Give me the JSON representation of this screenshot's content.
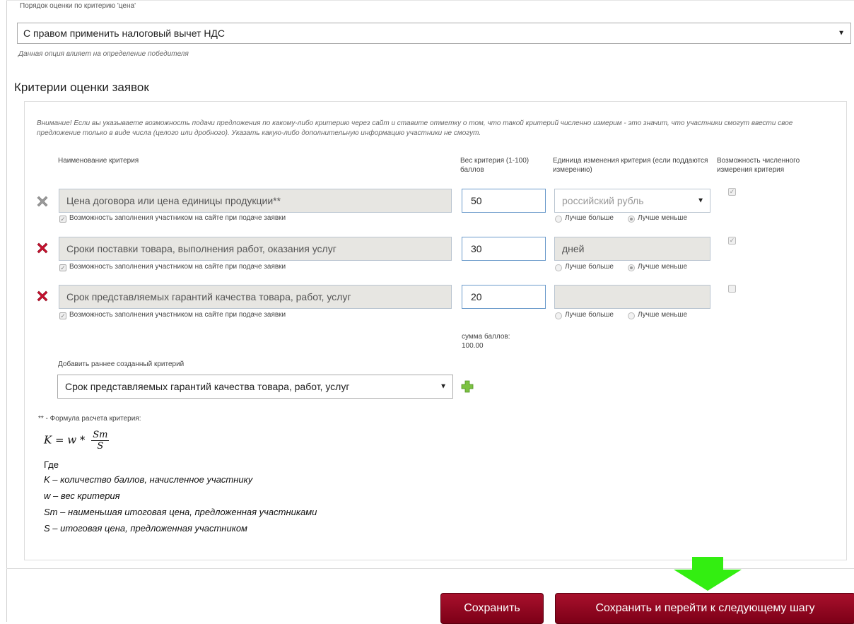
{
  "vat": {
    "label": "Порядок оценки по критерию 'цена'",
    "value": "С правом применить налоговый вычет НДС",
    "hint": "Данная опция влияет на определение победителя"
  },
  "section_title": "Критерии оценки заявок",
  "warning": "Внимание! Если вы указываете возможность подачи предложения по какому-либо критерию через сайт и ставите отметку о том, что такой критерий численно измерим - это значит, что участники смогут ввести свое предложение только в виде числа (целого или дробного). Указать какую-либо дополнительную информацию участники не смогут.",
  "columns": {
    "name": "Наименование критерия",
    "weight": "Вес критерия (1-100) баллов",
    "unit": "Единица изменения критерия (если поддаются измерению)",
    "measurable": "Возможность численного измерения критерия"
  },
  "criteria": [
    {
      "name": "Цена договора или цена единицы продукции**",
      "weight": "50",
      "unit": "российский рубль",
      "site_fill_label": "Возможность заполнения участником на сайте при подаче заявки",
      "better_more": "Лучше больше",
      "better_less": "Лучше меньше",
      "measurable_checked": true
    },
    {
      "name": "Сроки поставки товара, выполнения работ, оказания услуг",
      "weight": "30",
      "unit": "дней",
      "site_fill_label": "Возможность заполнения участником на сайте при подаче заявки",
      "better_more": "Лучше больше",
      "better_less": "Лучше меньше",
      "measurable_checked": true
    },
    {
      "name": "Срок представляемых гарантий качества товара, работ, услуг",
      "weight": "20",
      "unit": "",
      "site_fill_label": "Возможность заполнения участником на сайте при подаче заявки",
      "better_more": "Лучше больше",
      "better_less": "Лучше меньше",
      "measurable_checked": false
    }
  ],
  "sum_label": "сумма баллов:",
  "sum_value": "100.00",
  "add": {
    "label": "Добавить раннее созданный критерий",
    "value": "Срок представляемых гарантий качества товара, работ, услуг"
  },
  "formula": {
    "note": "** - Формула расчета критерия:",
    "lhs": "K = w *",
    "num": "Sm",
    "den": "S",
    "where": "Где",
    "lines": [
      "K – количество баллов, начисленное участнику",
      "w – вес критерия",
      "Sm – наименьшая итоговая цена, предложенная участниками",
      "S – итоговая цена, предложенная участником"
    ]
  },
  "buttons": {
    "save": "Сохранить",
    "save_next": "Сохранить и перейти к следующему шагу"
  },
  "colors": {
    "button": "#8c0a22",
    "delete_active": "#c8102e",
    "delete_disabled": "#9a9a9a",
    "arrow": "#33ee11",
    "plus": "#7cc242"
  }
}
